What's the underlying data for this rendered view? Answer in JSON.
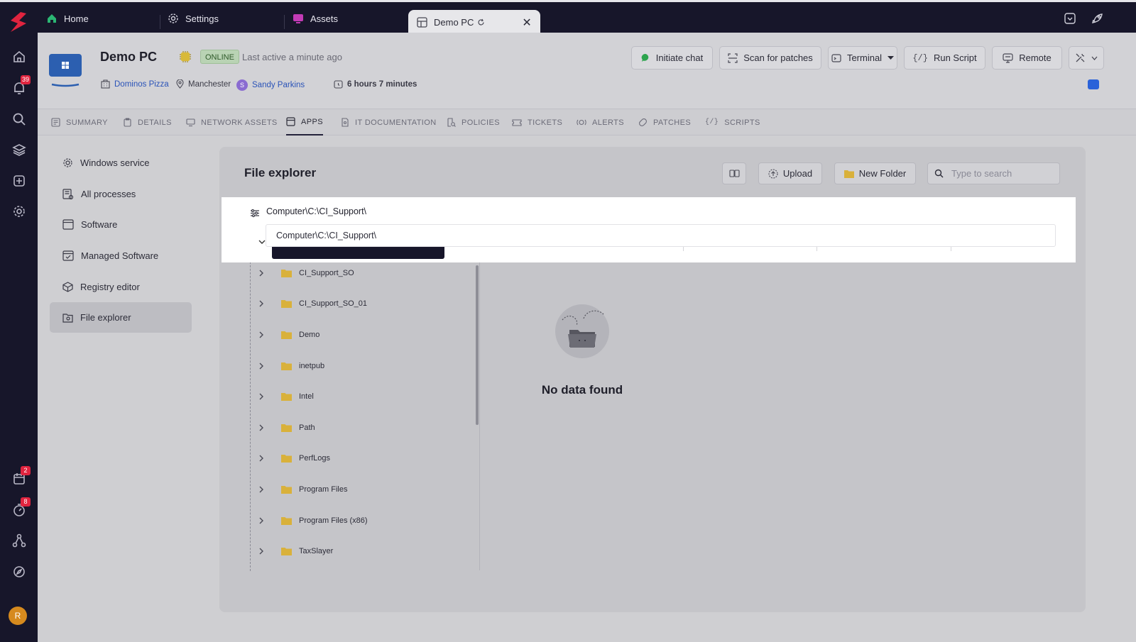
{
  "rail": {
    "badges": {
      "notifications": "39",
      "calendar": "2",
      "timer": "8"
    },
    "avatar_initial": "R"
  },
  "tabs": [
    {
      "label": "Home",
      "icon": "home-icon"
    },
    {
      "label": "Settings",
      "icon": "gear-icon"
    },
    {
      "label": "Assets",
      "icon": "monitor-icon"
    },
    {
      "label": "Demo PC",
      "icon": "windows-icon",
      "active": true
    }
  ],
  "device": {
    "name": "Demo PC",
    "status": "ONLINE",
    "last_active": "Last active a minute ago",
    "company": "Dominos Pizza",
    "location": "Manchester",
    "user_initial": "S",
    "user": "Sandy Parkins",
    "uptime": "6 hours 7 minutes"
  },
  "actions": {
    "initiate_chat": "Initiate chat",
    "scan_patches": "Scan for patches",
    "terminal": "Terminal",
    "run_script": "Run Script",
    "remote": "Remote"
  },
  "subtabs": [
    {
      "label": "SUMMARY"
    },
    {
      "label": "DETAILS"
    },
    {
      "label": "NETWORK ASSETS"
    },
    {
      "label": "APPS",
      "active": true
    },
    {
      "label": "IT DOCUMENTATION"
    },
    {
      "label": "POLICIES"
    },
    {
      "label": "TICKETS"
    },
    {
      "label": "ALERTS"
    },
    {
      "label": "PATCHES"
    },
    {
      "label": "SCRIPTS"
    }
  ],
  "apps_menu": [
    {
      "label": "Windows service"
    },
    {
      "label": "All processes"
    },
    {
      "label": "Software"
    },
    {
      "label": "Managed Software"
    },
    {
      "label": "Registry editor"
    },
    {
      "label": "File explorer",
      "active": true
    }
  ],
  "explorer": {
    "title": "File explorer",
    "upload": "Upload",
    "new_folder": "New Folder",
    "search_placeholder": "Type to search",
    "path_value": "Computer\\C:\\CI_Support\\",
    "suggestion": "Computer\\C:\\CI_Support\\",
    "folders": [
      "CI_Support_SO",
      "CI_Support_SO_01",
      "Demo",
      "inetpub",
      "Intel",
      "Path",
      "PerfLogs",
      "Program Files",
      "Program Files (x86)",
      "TaxSlayer"
    ],
    "empty_text": "No data found"
  },
  "colors": {
    "rail_bg": "#17162a",
    "accent_red": "#e0243f",
    "link_blue": "#2a53b8",
    "online_green": "#2f5a2a",
    "folder_yellow": "#d9b13b"
  }
}
